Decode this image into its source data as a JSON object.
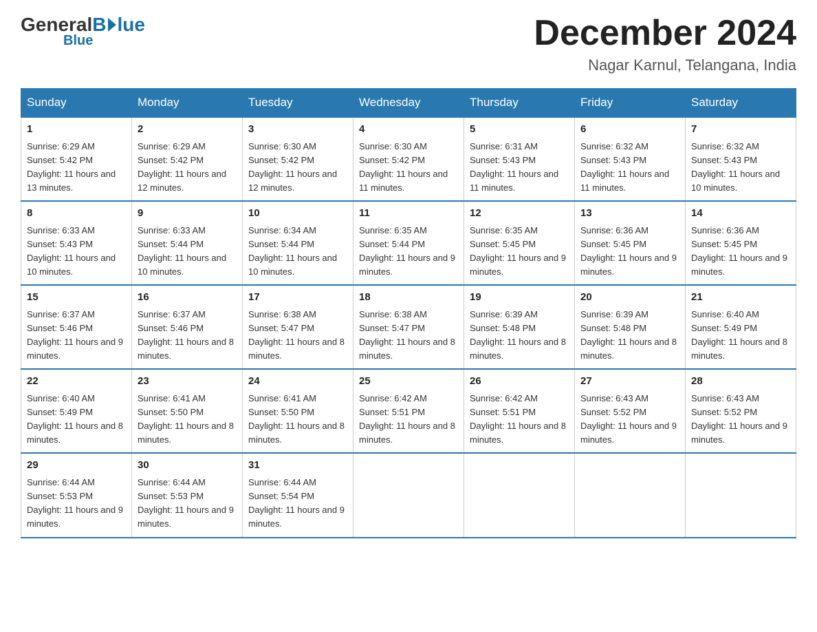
{
  "logo": {
    "general": "General",
    "blue": "Blue",
    "line2": "Blue"
  },
  "title": {
    "month_year": "December 2024",
    "location": "Nagar Karnul, Telangana, India"
  },
  "headers": [
    "Sunday",
    "Monday",
    "Tuesday",
    "Wednesday",
    "Thursday",
    "Friday",
    "Saturday"
  ],
  "weeks": [
    [
      {
        "day": "1",
        "sunrise": "6:29 AM",
        "sunset": "5:42 PM",
        "daylight": "11 hours and 13 minutes."
      },
      {
        "day": "2",
        "sunrise": "6:29 AM",
        "sunset": "5:42 PM",
        "daylight": "11 hours and 12 minutes."
      },
      {
        "day": "3",
        "sunrise": "6:30 AM",
        "sunset": "5:42 PM",
        "daylight": "11 hours and 12 minutes."
      },
      {
        "day": "4",
        "sunrise": "6:30 AM",
        "sunset": "5:42 PM",
        "daylight": "11 hours and 11 minutes."
      },
      {
        "day": "5",
        "sunrise": "6:31 AM",
        "sunset": "5:43 PM",
        "daylight": "11 hours and 11 minutes."
      },
      {
        "day": "6",
        "sunrise": "6:32 AM",
        "sunset": "5:43 PM",
        "daylight": "11 hours and 11 minutes."
      },
      {
        "day": "7",
        "sunrise": "6:32 AM",
        "sunset": "5:43 PM",
        "daylight": "11 hours and 10 minutes."
      }
    ],
    [
      {
        "day": "8",
        "sunrise": "6:33 AM",
        "sunset": "5:43 PM",
        "daylight": "11 hours and 10 minutes."
      },
      {
        "day": "9",
        "sunrise": "6:33 AM",
        "sunset": "5:44 PM",
        "daylight": "11 hours and 10 minutes."
      },
      {
        "day": "10",
        "sunrise": "6:34 AM",
        "sunset": "5:44 PM",
        "daylight": "11 hours and 10 minutes."
      },
      {
        "day": "11",
        "sunrise": "6:35 AM",
        "sunset": "5:44 PM",
        "daylight": "11 hours and 9 minutes."
      },
      {
        "day": "12",
        "sunrise": "6:35 AM",
        "sunset": "5:45 PM",
        "daylight": "11 hours and 9 minutes."
      },
      {
        "day": "13",
        "sunrise": "6:36 AM",
        "sunset": "5:45 PM",
        "daylight": "11 hours and 9 minutes."
      },
      {
        "day": "14",
        "sunrise": "6:36 AM",
        "sunset": "5:45 PM",
        "daylight": "11 hours and 9 minutes."
      }
    ],
    [
      {
        "day": "15",
        "sunrise": "6:37 AM",
        "sunset": "5:46 PM",
        "daylight": "11 hours and 9 minutes."
      },
      {
        "day": "16",
        "sunrise": "6:37 AM",
        "sunset": "5:46 PM",
        "daylight": "11 hours and 8 minutes."
      },
      {
        "day": "17",
        "sunrise": "6:38 AM",
        "sunset": "5:47 PM",
        "daylight": "11 hours and 8 minutes."
      },
      {
        "day": "18",
        "sunrise": "6:38 AM",
        "sunset": "5:47 PM",
        "daylight": "11 hours and 8 minutes."
      },
      {
        "day": "19",
        "sunrise": "6:39 AM",
        "sunset": "5:48 PM",
        "daylight": "11 hours and 8 minutes."
      },
      {
        "day": "20",
        "sunrise": "6:39 AM",
        "sunset": "5:48 PM",
        "daylight": "11 hours and 8 minutes."
      },
      {
        "day": "21",
        "sunrise": "6:40 AM",
        "sunset": "5:49 PM",
        "daylight": "11 hours and 8 minutes."
      }
    ],
    [
      {
        "day": "22",
        "sunrise": "6:40 AM",
        "sunset": "5:49 PM",
        "daylight": "11 hours and 8 minutes."
      },
      {
        "day": "23",
        "sunrise": "6:41 AM",
        "sunset": "5:50 PM",
        "daylight": "11 hours and 8 minutes."
      },
      {
        "day": "24",
        "sunrise": "6:41 AM",
        "sunset": "5:50 PM",
        "daylight": "11 hours and 8 minutes."
      },
      {
        "day": "25",
        "sunrise": "6:42 AM",
        "sunset": "5:51 PM",
        "daylight": "11 hours and 8 minutes."
      },
      {
        "day": "26",
        "sunrise": "6:42 AM",
        "sunset": "5:51 PM",
        "daylight": "11 hours and 8 minutes."
      },
      {
        "day": "27",
        "sunrise": "6:43 AM",
        "sunset": "5:52 PM",
        "daylight": "11 hours and 9 minutes."
      },
      {
        "day": "28",
        "sunrise": "6:43 AM",
        "sunset": "5:52 PM",
        "daylight": "11 hours and 9 minutes."
      }
    ],
    [
      {
        "day": "29",
        "sunrise": "6:44 AM",
        "sunset": "5:53 PM",
        "daylight": "11 hours and 9 minutes."
      },
      {
        "day": "30",
        "sunrise": "6:44 AM",
        "sunset": "5:53 PM",
        "daylight": "11 hours and 9 minutes."
      },
      {
        "day": "31",
        "sunrise": "6:44 AM",
        "sunset": "5:54 PM",
        "daylight": "11 hours and 9 minutes."
      },
      null,
      null,
      null,
      null
    ]
  ],
  "labels": {
    "sunrise": "Sunrise:",
    "sunset": "Sunset:",
    "daylight": "Daylight:"
  }
}
